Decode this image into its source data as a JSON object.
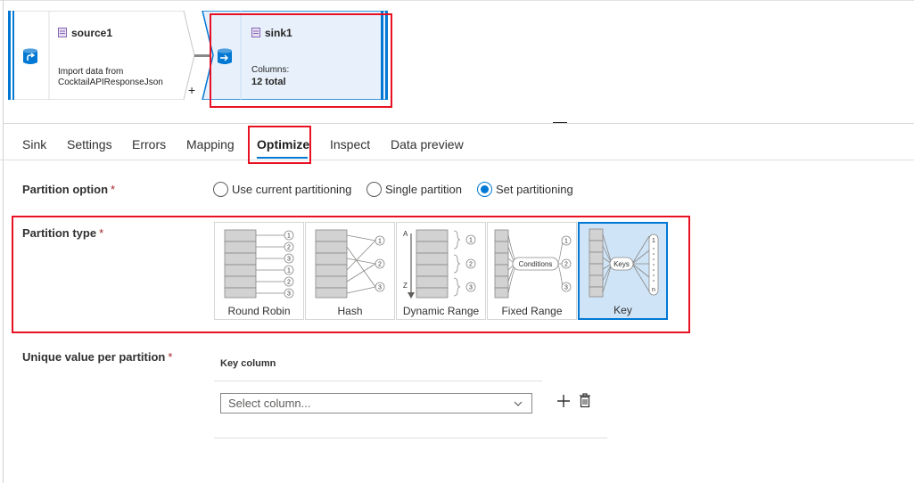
{
  "source_node": {
    "title": "source1",
    "desc_line1": "Import data from",
    "desc_line2": "CocktailAPIResponseJson"
  },
  "sink_node": {
    "title": "sink1",
    "columns_label": "Columns:",
    "columns_value": "12 total"
  },
  "canvas": {
    "add_label": "+"
  },
  "tabs": [
    {
      "label": "Sink"
    },
    {
      "label": "Settings"
    },
    {
      "label": "Errors"
    },
    {
      "label": "Mapping"
    },
    {
      "label": "Optimize"
    },
    {
      "label": "Inspect"
    },
    {
      "label": "Data preview"
    }
  ],
  "active_tab": "Optimize",
  "partition_option": {
    "label": "Partition option",
    "required_mark": "*",
    "options": [
      {
        "label": "Use current partitioning",
        "selected": false
      },
      {
        "label": "Single partition",
        "selected": false
      },
      {
        "label": "Set partitioning",
        "selected": true
      }
    ]
  },
  "partition_type": {
    "label": "Partition type",
    "required_mark": "*",
    "tiles": [
      {
        "label": "Round Robin",
        "selected": false
      },
      {
        "label": "Hash",
        "selected": false
      },
      {
        "label": "Dynamic Range",
        "selected": false
      },
      {
        "label": "Fixed Range",
        "selected": false
      },
      {
        "label": "Key",
        "selected": true
      }
    ],
    "diagram_text": {
      "n1": "1",
      "n2": "2",
      "n3": "3",
      "n_last": "n",
      "range_start": "A",
      "range_end": "Z",
      "conditions": "Conditions",
      "keys": "Keys"
    }
  },
  "unique_value": {
    "label": "Unique value per partition",
    "required_mark": "*",
    "column_header": "Key column",
    "select_placeholder": "Select column..."
  },
  "colors": {
    "accent": "#0078d4",
    "highlight": "#e81123",
    "tile_selected": "#cfe4f7"
  }
}
